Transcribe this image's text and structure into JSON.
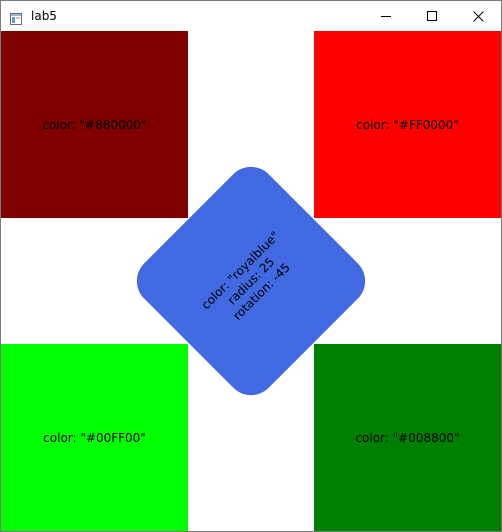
{
  "window": {
    "title": "lab5",
    "app_icon": "window-app-icon",
    "controls": {
      "minimize_icon": "minimize-icon",
      "maximize_icon": "maximize-icon",
      "close_icon": "close-icon"
    }
  },
  "rectangles": [
    {
      "label": "color: \"#880000\"",
      "color": "#800000"
    },
    {
      "label": "color: \"#FF0000\"",
      "color": "#FF0000"
    },
    {
      "label": "color: \"#00FF00\"",
      "color": "#00FF00"
    },
    {
      "label": "color: \"#008800\"",
      "color": "#008000"
    }
  ],
  "diamond": {
    "color": "royalblue",
    "color_hex": "#4169E1",
    "lines": [
      "color: \"royalblue\"",
      "radius: 25",
      "rotation: -45"
    ]
  }
}
